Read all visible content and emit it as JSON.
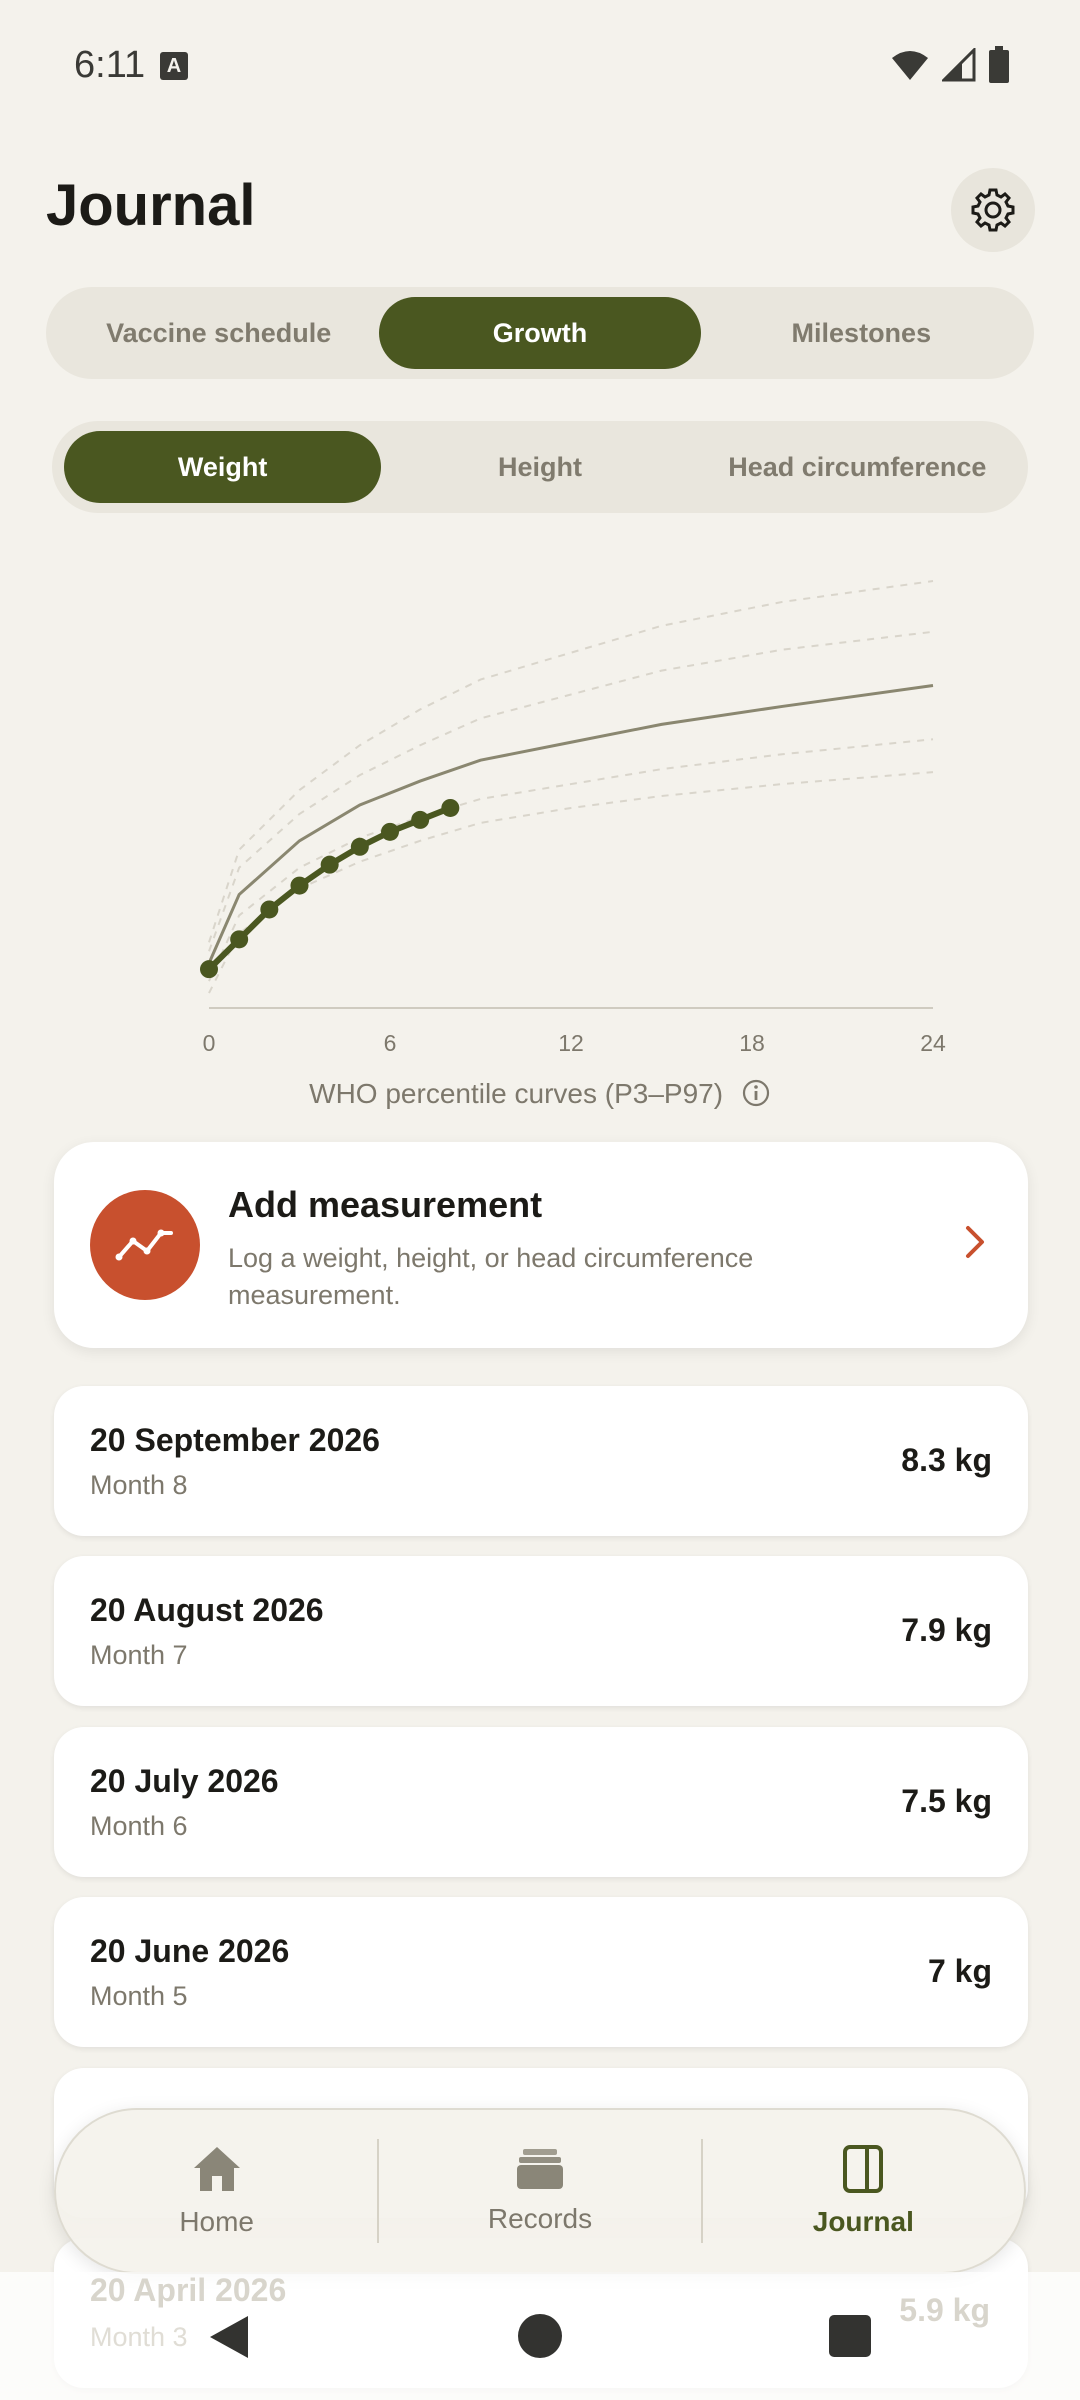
{
  "status_bar": {
    "time": "6:11",
    "notification_icon": "A"
  },
  "header": {
    "title": "Journal"
  },
  "main_tabs": [
    {
      "label": "Vaccine schedule",
      "active": false
    },
    {
      "label": "Growth",
      "active": true
    },
    {
      "label": "Milestones",
      "active": false
    }
  ],
  "sub_tabs": [
    {
      "label": "Weight",
      "active": true
    },
    {
      "label": "Height",
      "active": false
    },
    {
      "label": "Head circumference",
      "active": false
    }
  ],
  "chart_data": {
    "type": "line",
    "x_ticks": [
      "0",
      "6",
      "12",
      "18",
      "24"
    ],
    "xlim": [
      0,
      24
    ],
    "ylim": [
      2,
      16
    ],
    "series": [
      {
        "name": "",
        "x": [
          0,
          1,
          2,
          3,
          4,
          5,
          6,
          7,
          8
        ],
        "values": [
          3.3,
          4.3,
          5.3,
          6.1,
          6.8,
          7.4,
          7.9,
          8.3,
          8.7
        ]
      }
    ],
    "percentiles": [
      {
        "name": "",
        "values": [
          4.2,
          7.3,
          9.3,
          10.8,
          12.0,
          13.0,
          13.9,
          14.8,
          15.6,
          16.3
        ]
      },
      {
        "name": "",
        "values": [
          3.9,
          6.7,
          8.5,
          9.8,
          10.8,
          11.7,
          12.5,
          13.3,
          14.0,
          14.6
        ]
      },
      {
        "name": "",
        "values": [
          3.5,
          5.8,
          7.6,
          8.8,
          9.6,
          10.3,
          10.9,
          11.5,
          12.1,
          12.8
        ]
      },
      {
        "name": "",
        "values": [
          2.9,
          5.1,
          6.7,
          7.7,
          8.4,
          9.0,
          9.5,
          10.0,
          10.5,
          11.0
        ]
      },
      {
        "name": "",
        "values": [
          2.5,
          4.5,
          6.0,
          6.9,
          7.6,
          8.2,
          8.7,
          9.1,
          9.5,
          9.9
        ]
      }
    ],
    "percentile_x": [
      0,
      1,
      3,
      5,
      7,
      9,
      12,
      15,
      19,
      24
    ],
    "colors": {
      "child": "#4a5720",
      "median": "#8a8770",
      "percentile": "#d9d5cb",
      "axis": "#cfcbc0"
    },
    "caption": "WHO percentile curves (P3–P97)"
  },
  "add_card": {
    "title": "Add measurement",
    "subtitle": "Log a weight, height, or head circumference measurement.",
    "icon": "trend-line-icon",
    "accent": "#c8502e"
  },
  "entries": [
    {
      "date": "20 September 2026",
      "month": "Month 8",
      "value": "8.3 kg"
    },
    {
      "date": "20 August 2026",
      "month": "Month 7",
      "value": "7.9 kg"
    },
    {
      "date": "20 July 2026",
      "month": "Month 6",
      "value": "7.5 kg"
    },
    {
      "date": "20 June 2026",
      "month": "Month 5",
      "value": "7 kg"
    }
  ],
  "ghost_entry": {
    "date": "20 April 2026",
    "month": "Month 3",
    "value": "5.9 kg"
  },
  "bottom_nav": [
    {
      "label": "Home",
      "icon": "home-icon",
      "active": false
    },
    {
      "label": "Records",
      "icon": "records-icon",
      "active": false
    },
    {
      "label": "Journal",
      "icon": "journal-icon",
      "active": true
    }
  ],
  "colors": {
    "accent": "#4a5720",
    "background": "#f4f2ec",
    "cta": "#c8502e"
  }
}
